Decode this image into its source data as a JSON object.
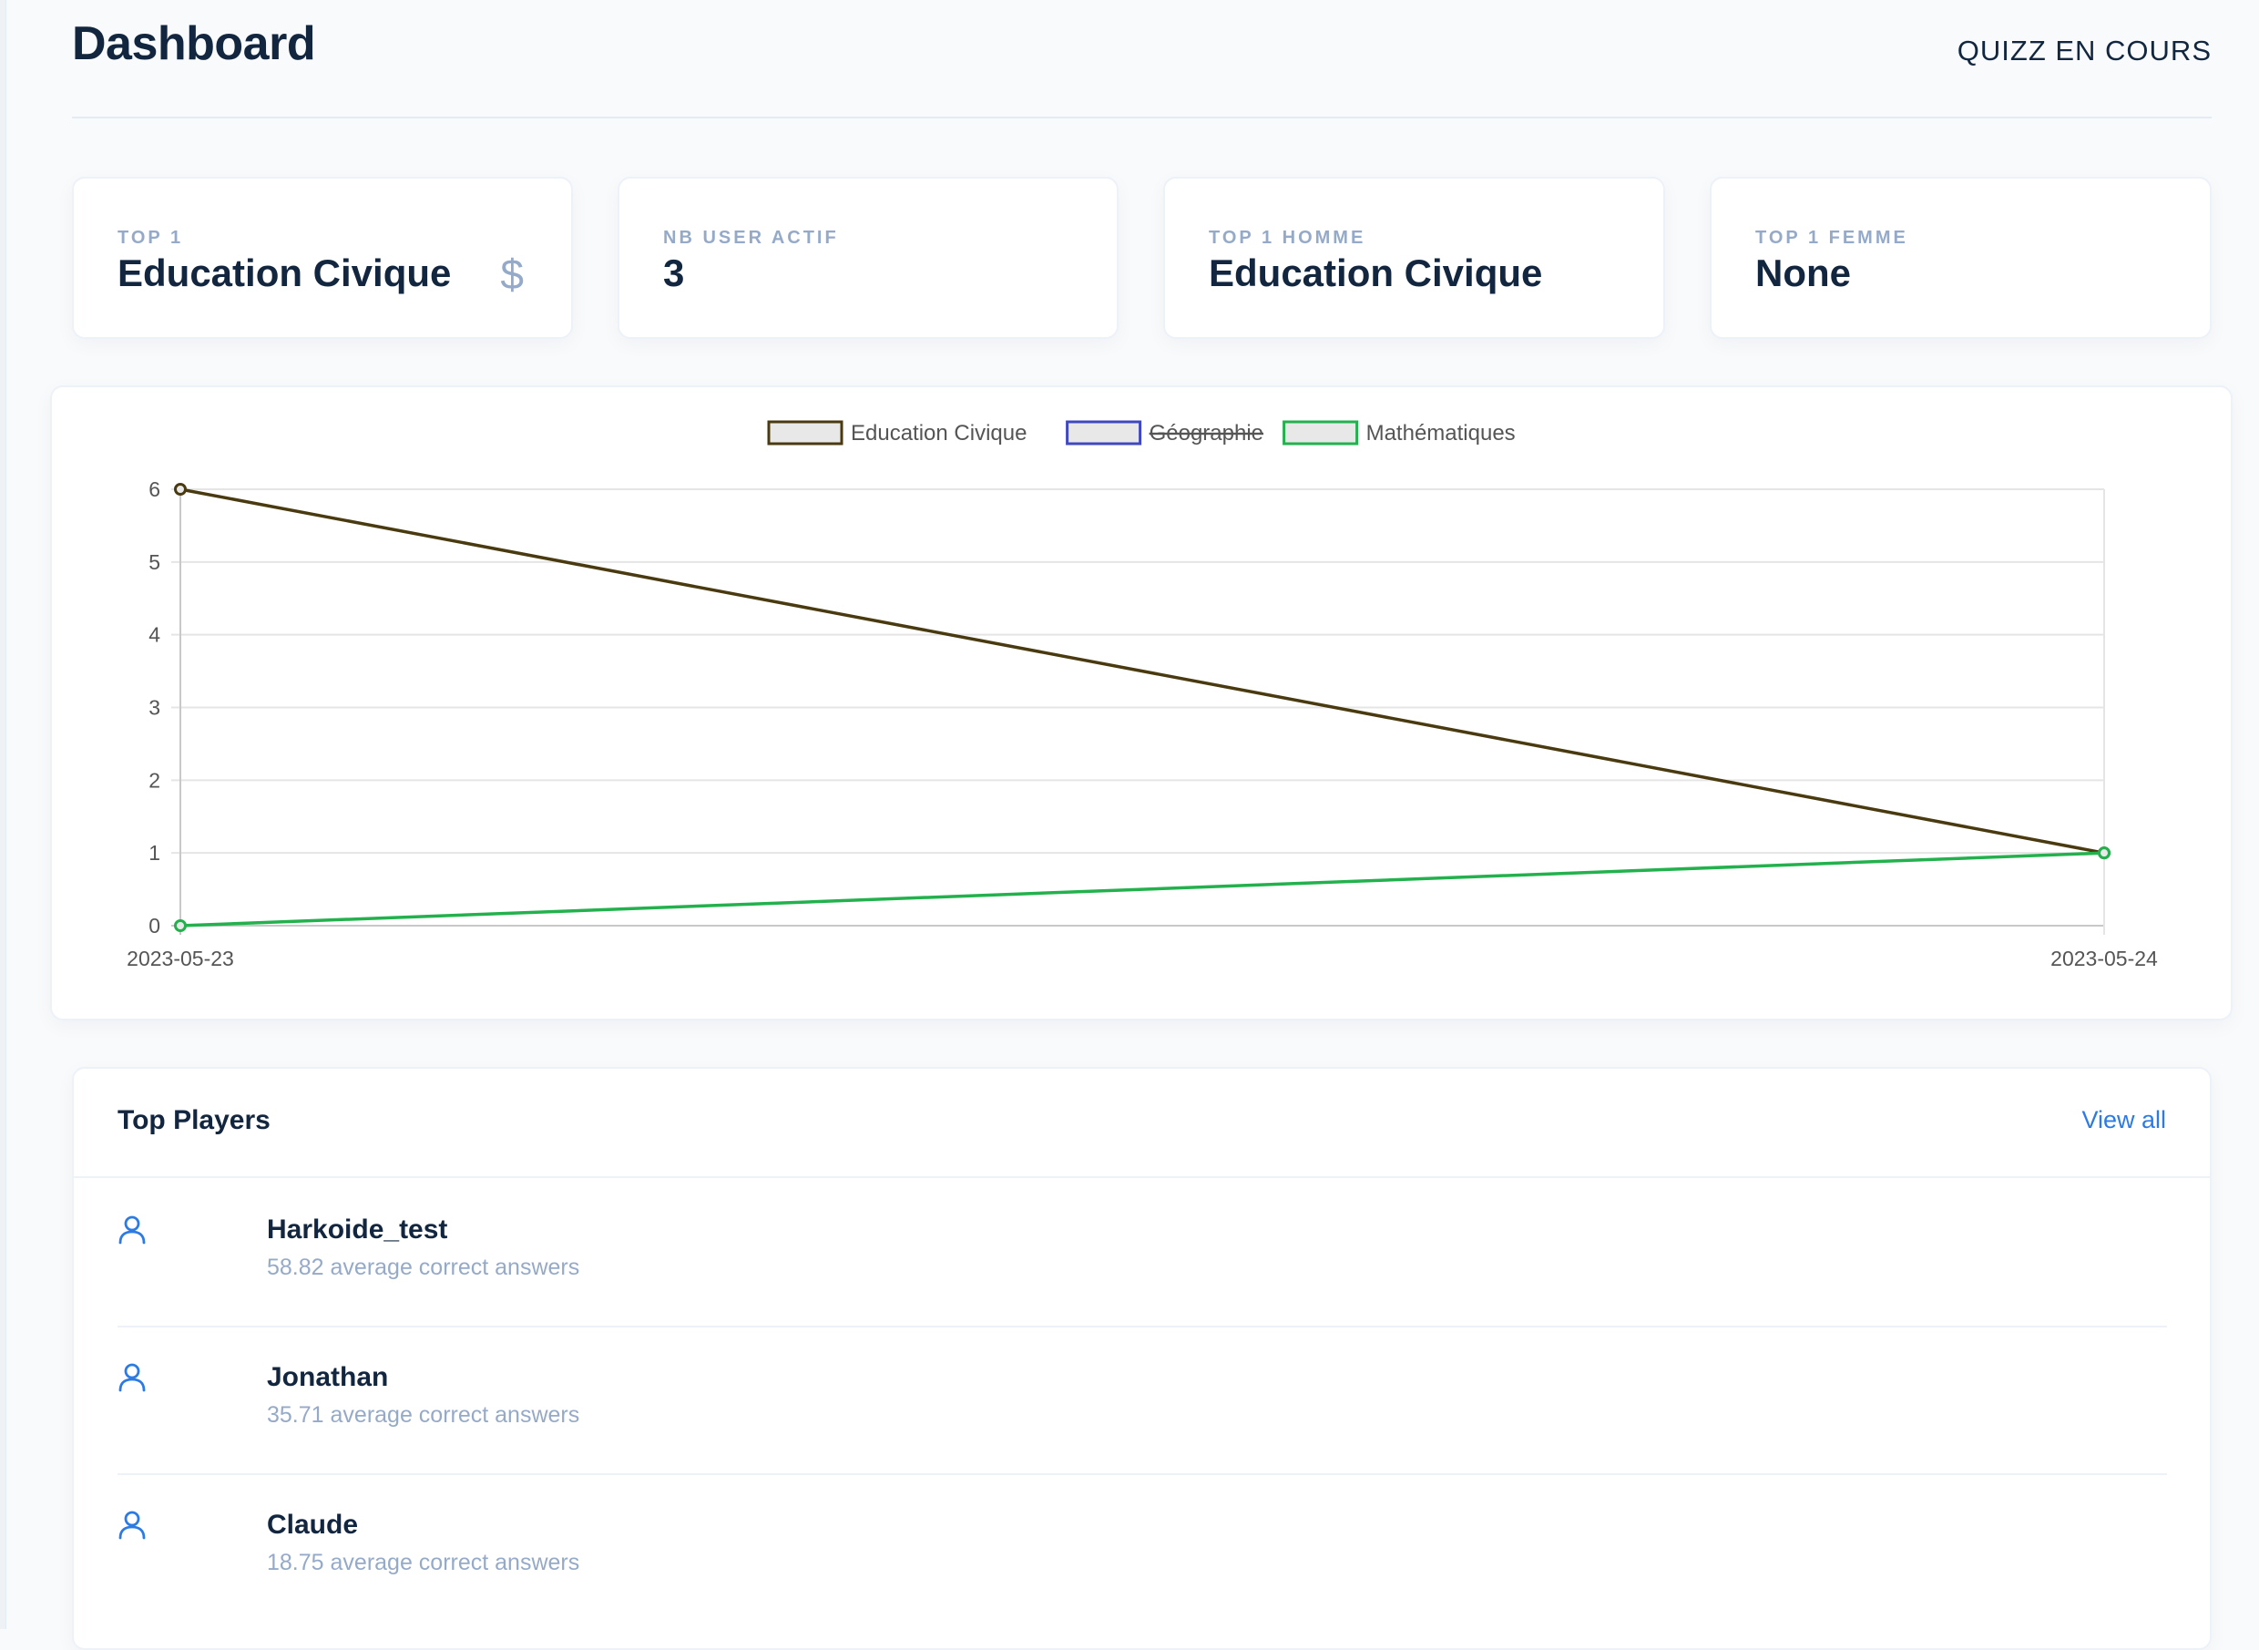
{
  "header": {
    "title": "Dashboard",
    "right_link": "QUIZZ EN COURS"
  },
  "stats": [
    {
      "label": "TOP 1",
      "value": "Education Civique",
      "icon": "dollar-icon"
    },
    {
      "label": "NB USER ACTIF",
      "value": "3"
    },
    {
      "label": "TOP 1 HOMME",
      "value": "Education Civique"
    },
    {
      "label": "TOP 1 FEMME",
      "value": "None"
    }
  ],
  "chart_data": {
    "type": "line",
    "x": [
      "2023-05-23",
      "2023-05-24"
    ],
    "ylim": [
      0,
      6
    ],
    "yticks": [
      0,
      1,
      2,
      3,
      4,
      5,
      6
    ],
    "grid": true,
    "legend_position": "top",
    "series": [
      {
        "name": "Education Civique",
        "values": [
          6,
          1
        ],
        "color": "#4a3a10",
        "hidden": false
      },
      {
        "name": "Géographie",
        "values": [],
        "color": "#4048c0",
        "hidden": true
      },
      {
        "name": "Mathématiques",
        "values": [
          0,
          1
        ],
        "color": "#22b14c",
        "hidden": false
      }
    ]
  },
  "players": {
    "title": "Top Players",
    "view_all": "View all",
    "items": [
      {
        "name": "Harkoide_test",
        "subtitle": "58.82 average correct answers"
      },
      {
        "name": "Jonathan",
        "subtitle": "35.71 average correct answers"
      },
      {
        "name": "Claude",
        "subtitle": "18.75 average correct answers"
      }
    ]
  }
}
